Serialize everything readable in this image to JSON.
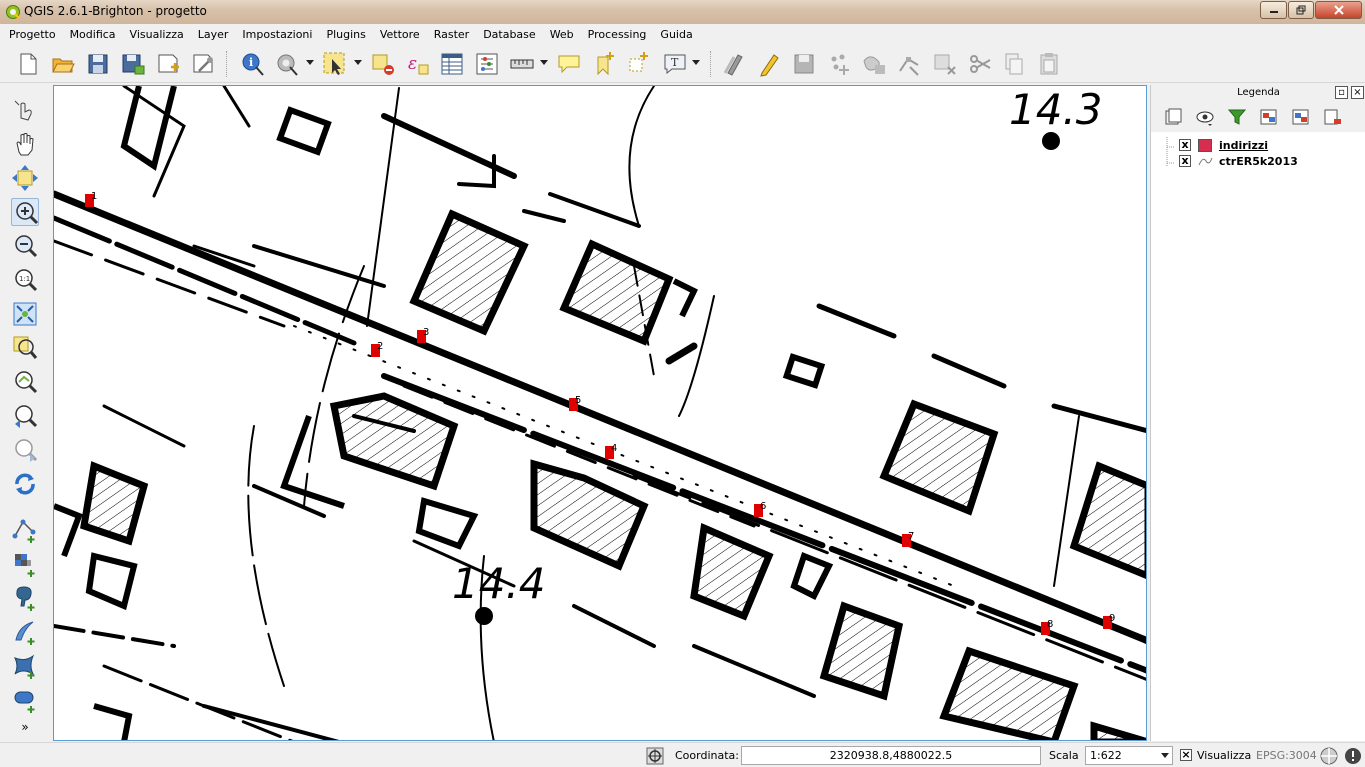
{
  "window": {
    "title": "QGIS 2.6.1-Brighton - progetto",
    "title_bg": "#d8c1aa"
  },
  "menubar": {
    "items": [
      "Progetto",
      "Modifica",
      "Visualizza",
      "Layer",
      "Impostazioni",
      "Plugins",
      "Vettore",
      "Raster",
      "Database",
      "Web",
      "Processing",
      "Guida"
    ]
  },
  "toolbar": {
    "icons": [
      "new-project-icon",
      "open-project-icon",
      "save-project-icon",
      "save-as-icon",
      "new-print-composer-icon",
      "composer-manager-icon",
      "identify-icon",
      "run-feature-action-icon",
      "select-features-icon",
      "deselect-all-icon",
      "expression-icon",
      "attribute-table-icon",
      "field-calculator-icon",
      "measure-icon",
      "map-tips-icon",
      "new-bookmark-icon",
      "show-bookmarks-icon",
      "text-annotation-icon",
      "current-edits-icon",
      "toggle-editing-icon",
      "save-layer-edits-icon",
      "add-feature-icon",
      "move-feature-icon",
      "node-tool-icon",
      "delete-selected-icon",
      "cut-features-icon",
      "copy-features-icon",
      "paste-features-icon"
    ]
  },
  "left_toolbar": {
    "icons": [
      "touch-zoom-icon",
      "pan-icon",
      "pan-to-selection-icon",
      "zoom-in-icon",
      "zoom-out-icon",
      "zoom-native-icon",
      "zoom-full-icon",
      "zoom-to-selection-icon",
      "zoom-to-layer-icon",
      "zoom-last-icon",
      "zoom-next-icon",
      "refresh-icon",
      "add-vector-layer-icon",
      "add-raster-layer-icon",
      "add-postgis-layer-icon",
      "add-spatialite-layer-icon",
      "add-mssql-layer-icon",
      "add-oracle-layer-icon",
      "more-tools-icon"
    ],
    "more_label": "»"
  },
  "map": {
    "markers": [
      {
        "label": "1"
      },
      {
        "label": "2"
      },
      {
        "label": "3"
      },
      {
        "label": "4"
      },
      {
        "label": "5"
      },
      {
        "label": "6"
      },
      {
        "label": "7"
      },
      {
        "label": "8"
      },
      {
        "label": "9"
      }
    ],
    "spot_heights": [
      "14.3",
      "14.4"
    ],
    "marker_color": "#e00000",
    "border_color": "#5a9bd5"
  },
  "legend": {
    "title": "Legenda",
    "layers": [
      {
        "name": "indirizzi",
        "checked": true,
        "swatch": "#d62e50",
        "checked_mark": "x"
      },
      {
        "name": "ctrER5k2013",
        "checked": true,
        "swatch": "",
        "checked_mark": "x"
      }
    ],
    "toolbar_icons": [
      "add-group-icon",
      "manage-visibility-icon",
      "filter-legend-icon",
      "expand-all-icon",
      "collapse-all-icon",
      "remove-layer-icon"
    ]
  },
  "statusbar": {
    "coord_label": "Coordinata:",
    "coord_value": "2320938.8,4880022.5",
    "scale_label": "Scala",
    "scale_value": "1:622",
    "render_label": "Visualizza",
    "render_checked": true,
    "epsg": "EPSG:3004"
  }
}
